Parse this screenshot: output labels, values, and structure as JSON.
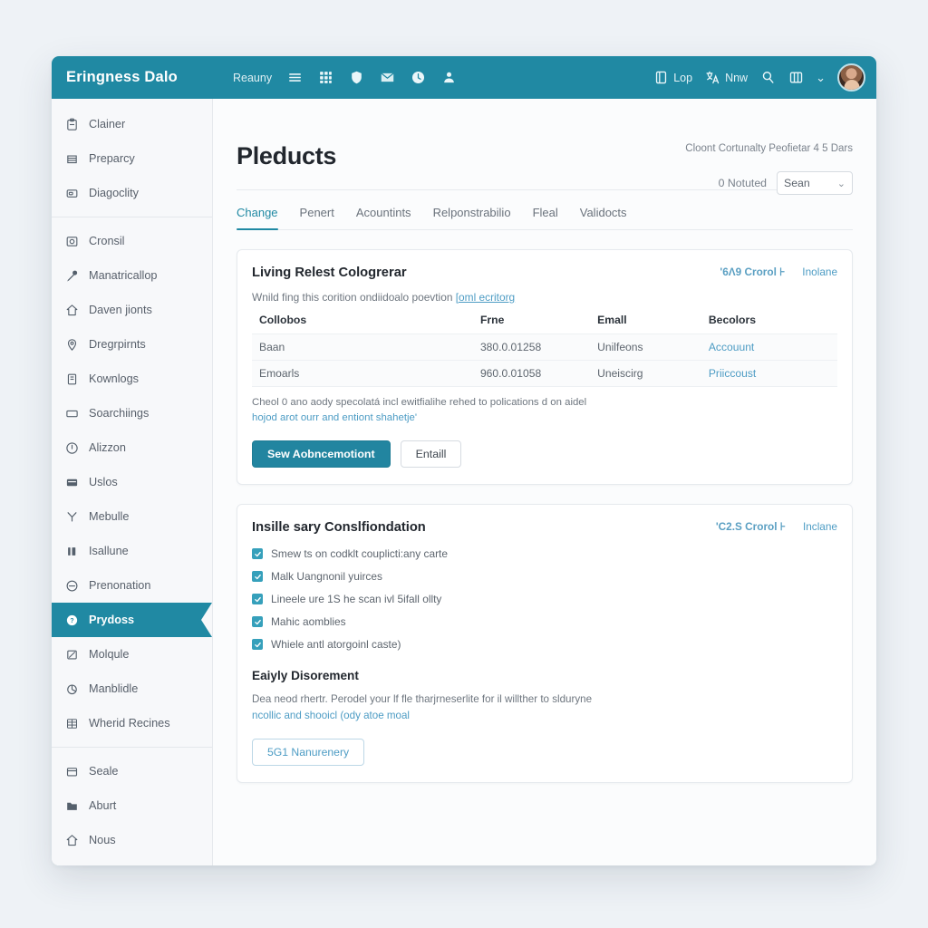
{
  "topbar": {
    "brand": "Eringness Dalo",
    "nav_link": "Reauny",
    "icons": [
      "list-icon",
      "grid-icon",
      "shield-icon",
      "envelope-icon",
      "clock-icon",
      "person-icon"
    ],
    "right": {
      "item1_label": "Lop",
      "item1_icon": "panel-icon",
      "item2_label": "Nnw",
      "item2_icon": "translate-icon",
      "search_icon": "search-icon",
      "view_icon": "layout-icon",
      "chevron": "⌄",
      "avatar": "user-avatar"
    },
    "accent_color": "#2089a3"
  },
  "sidebar": {
    "groups": [
      {
        "items": [
          {
            "label": "Clainer",
            "icon": "clipboard-icon",
            "active": false
          },
          {
            "label": "Preparcy",
            "icon": "file-icon",
            "active": false
          },
          {
            "label": "Diagoclity",
            "icon": "badge-icon",
            "active": false
          }
        ]
      },
      {
        "items": [
          {
            "label": "Cronsil",
            "icon": "image-icon",
            "active": false
          },
          {
            "label": "Manatricallop",
            "icon": "microphone-icon",
            "active": false
          },
          {
            "label": "Daven jionts",
            "icon": "home-icon",
            "active": false
          },
          {
            "label": "Dregrpirnts",
            "icon": "map-pin-icon",
            "active": false
          },
          {
            "label": "Kownlogs",
            "icon": "book-icon",
            "active": false
          },
          {
            "label": "Soarchiings",
            "icon": "window-icon",
            "active": false
          },
          {
            "label": "Alizzon",
            "icon": "alert-icon",
            "active": false
          },
          {
            "label": "Uslos",
            "icon": "card-icon",
            "active": false
          },
          {
            "label": "Mebulle",
            "icon": "branch-icon",
            "active": false
          },
          {
            "label": "Isallune",
            "icon": "bars-icon",
            "active": false
          },
          {
            "label": "Prenonation",
            "icon": "minus-circle-icon",
            "active": false
          },
          {
            "label": "Prydoss",
            "icon": "help-circle-icon",
            "active": true
          },
          {
            "label": "Molqule",
            "icon": "square-slash-icon",
            "active": false
          },
          {
            "label": "Manblidle",
            "icon": "pie-chart-icon",
            "active": false
          },
          {
            "label": "Wherid Recines",
            "icon": "table-icon",
            "active": false
          }
        ]
      },
      {
        "items": [
          {
            "label": "Seale",
            "icon": "archive-icon",
            "active": false
          },
          {
            "label": "Aburt",
            "icon": "folder-icon",
            "active": false
          },
          {
            "label": "Nous",
            "icon": "home-outline-icon",
            "active": false
          }
        ]
      }
    ]
  },
  "main": {
    "meta_line": "Cloont Cortunalty Peofietar 4 5 Dars",
    "title": "Pleducts",
    "notified_label": "0 Notuted",
    "select_value": "Sean",
    "select_chevron": "⌄",
    "tabs": [
      {
        "label": "Change",
        "active": true
      },
      {
        "label": "Penert",
        "active": false
      },
      {
        "label": "Acountints",
        "active": false
      },
      {
        "label": "Relponstrabilio",
        "active": false
      },
      {
        "label": "Fleal",
        "active": false
      },
      {
        "label": "Validocts",
        "active": false
      }
    ],
    "card1": {
      "title": "Living Relest Cologrerar",
      "link_bold": "'6Λ9 Crorol ⊦",
      "link_plain": "Inolane",
      "subtitle": "Wnild fing this corition ondiidoalo poevtion",
      "subtitle_link": "[oml ecritorg",
      "table": {
        "headers": [
          "Collobos",
          "Frne",
          "Emall",
          "Becolors"
        ],
        "rows": [
          [
            "Baan",
            "380.0.01258",
            "Unilfeons",
            "Accouunt"
          ],
          [
            "Emoarls",
            "960.0.01058",
            "Uneiscirg",
            "Priiccoust"
          ]
        ]
      },
      "note_line1": "Cheol 0 ano aody specolatá incl ewitfialihe rehed to polications d on aidel",
      "note_line2": "hojod arot ourr and entiont shahetje'",
      "primary_button": "Sew Aobncemotiont",
      "secondary_button": "Entaill"
    },
    "card2": {
      "title": "Insille sary Conslfiondation",
      "link_bold": "'C2.S Crorol ⊦",
      "link_plain": "Inclane",
      "checklist": [
        "Smew ts on codklt couplicti:any carte",
        "Malk Uangnonil yuirces",
        "Lineele ure 1S he scan ivl 5ifall ollty",
        "Mahic aomblies",
        "Whiele antl atorgoinl caste)"
      ],
      "sub_head": "Eaiyly Disorement",
      "sub_text_line1": "Dea neod rhertr. Perodel your lf fle tharjrneserlite for il willther to slduryne",
      "sub_text_line2": "ncollic and shooicl (ody atoe moal",
      "outline_button": "5G1 Nanurenery"
    }
  }
}
